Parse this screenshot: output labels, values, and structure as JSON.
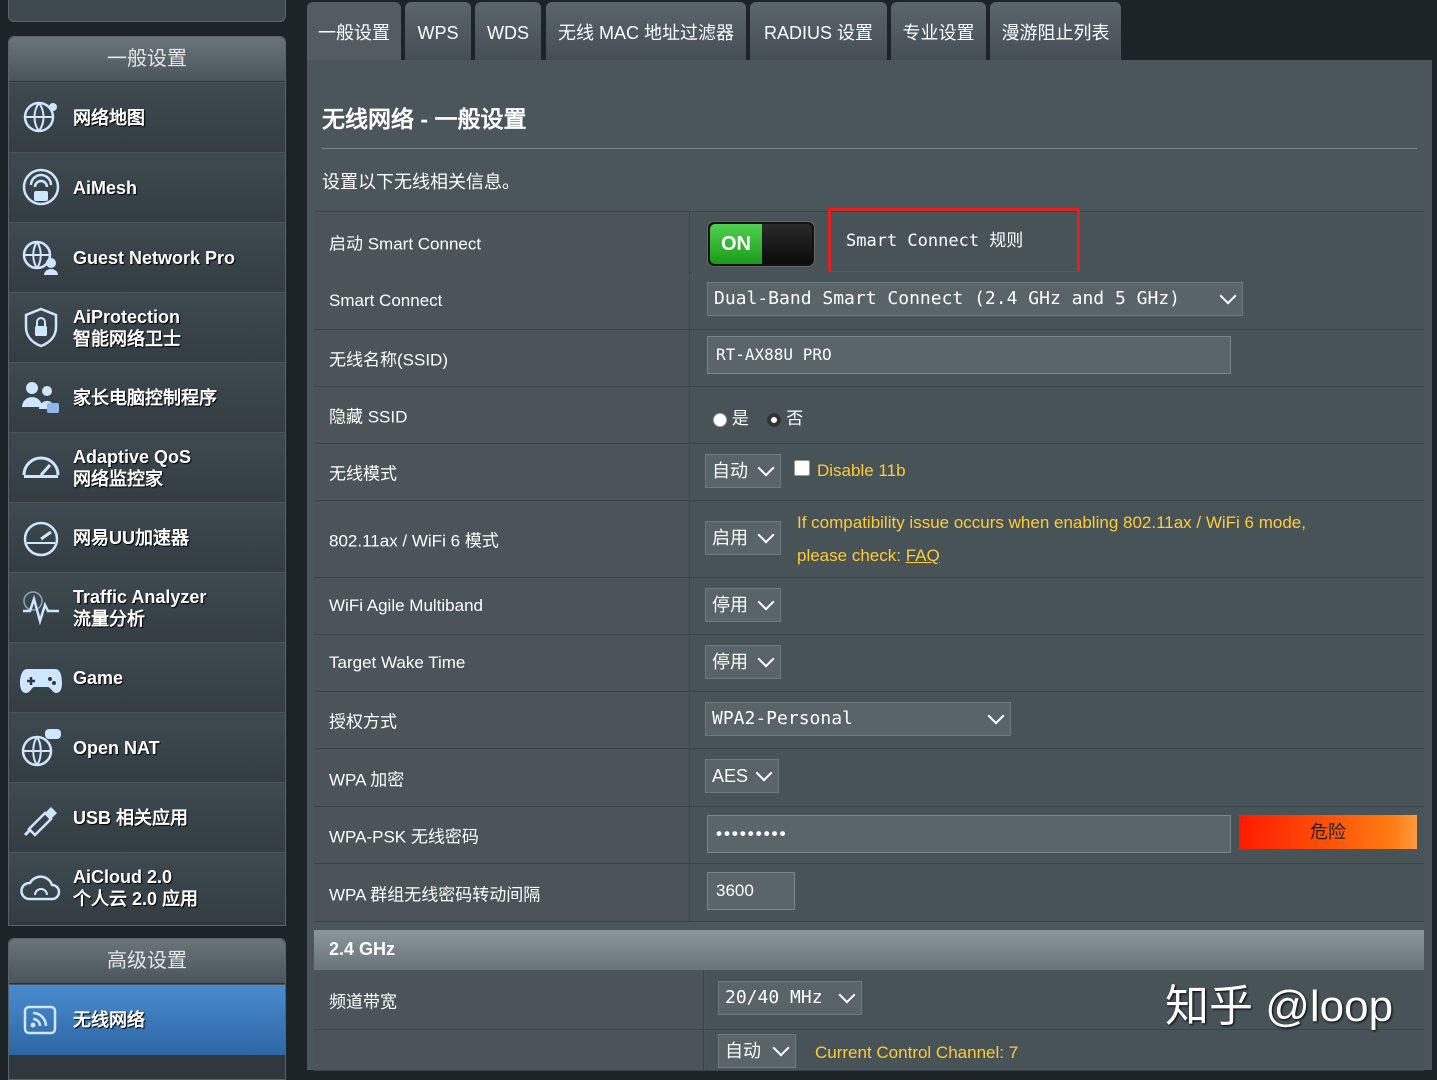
{
  "sidebar": {
    "general_header": "一般设置",
    "items": [
      {
        "icon": "globe-map-icon",
        "line1": "网络地图",
        "line2": ""
      },
      {
        "icon": "aimesh-icon",
        "line1": "AiMesh",
        "line2": ""
      },
      {
        "icon": "guest-network-icon",
        "line1": "Guest Network Pro",
        "line2": ""
      },
      {
        "icon": "shield-icon",
        "line1": "AiProtection",
        "line2": "智能网络卫士"
      },
      {
        "icon": "family-icon",
        "line1": "家长电脑控制程序",
        "line2": ""
      },
      {
        "icon": "gauge-icon",
        "line1": "Adaptive QoS",
        "line2": "网络监控家"
      },
      {
        "icon": "speedometer-icon",
        "line1": "网易UU加速器",
        "line2": ""
      },
      {
        "icon": "traffic-analyzer-icon",
        "line1": "Traffic Analyzer",
        "line2": "流量分析"
      },
      {
        "icon": "gamepad-icon",
        "line1": "Game",
        "line2": ""
      },
      {
        "icon": "open-nat-icon",
        "line1": "Open NAT",
        "line2": ""
      },
      {
        "icon": "usb-icon",
        "line1": "USB 相关应用",
        "line2": ""
      },
      {
        "icon": "cloud-icon",
        "line1": "AiCloud 2.0",
        "line2": "个人云 2.0 应用"
      }
    ],
    "advanced_header": "高级设置",
    "advanced_items": [
      {
        "icon": "wireless-icon",
        "line1": "无线网络"
      }
    ]
  },
  "tabs": [
    "一般设置",
    "WPS",
    "WDS",
    "无线 MAC 地址过滤器",
    "RADIUS 设置",
    "专业设置",
    "漫游阻止列表"
  ],
  "page": {
    "title": "无线网络 - 一般设置",
    "description": "设置以下无线相关信息。"
  },
  "rows": {
    "smart_connect_enable": {
      "label": "启动 Smart Connect",
      "toggle": "ON",
      "rule_link": "Smart Connect 规则"
    },
    "smart_connect": {
      "label": "Smart Connect",
      "value": "Dual-Band Smart Connect (2.4 GHz and 5 GHz)"
    },
    "ssid": {
      "label": "无线名称(SSID)",
      "value": "RT-AX88U PRO"
    },
    "hide_ssid": {
      "label": "隐藏 SSID",
      "opt_yes": "是",
      "opt_no": "否",
      "selected": "否"
    },
    "wireless_mode": {
      "label": "无线模式",
      "value": "自动",
      "checkbox_label": "Disable 11b"
    },
    "wifi6": {
      "label": "802.11ax / WiFi 6 模式",
      "value": "启用",
      "note_line1": "If compatibility issue occurs when enabling 802.11ax / WiFi 6 mode,",
      "note_prefix": "please check: ",
      "note_link": "FAQ"
    },
    "agile_multiband": {
      "label": "WiFi Agile Multiband",
      "value": "停用"
    },
    "twt": {
      "label": "Target Wake Time",
      "value": "停用"
    },
    "auth": {
      "label": "授权方式",
      "value": "WPA2-Personal"
    },
    "wpa_enc": {
      "label": "WPA 加密",
      "value": "AES"
    },
    "psk": {
      "label": "WPA-PSK 无线密码",
      "value": "•••••••••",
      "strength": "危险"
    },
    "group_key": {
      "label": "WPA 群组无线密码转动间隔",
      "value": "3600"
    }
  },
  "section_2g": {
    "title": "2.4 GHz",
    "bandwidth": {
      "label": "频道带宽",
      "value": "20/40 MHz"
    },
    "channel": {
      "label": "",
      "value": "自动",
      "note": "Current Control Channel: 7"
    }
  },
  "watermark": "知乎 @loop",
  "colors": {
    "accent_red": "#e02020",
    "note_yellow": "#ffcc33",
    "on_green": "#2db82d",
    "active_blue": "#3a7dc0"
  }
}
